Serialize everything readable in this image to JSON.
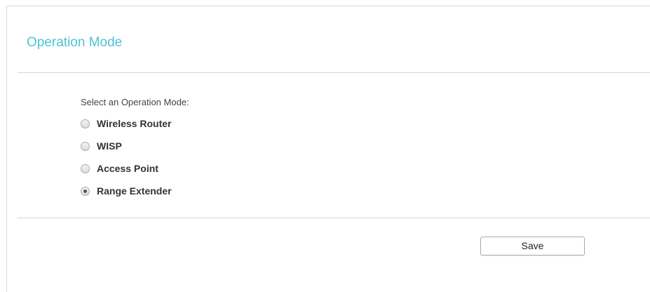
{
  "page": {
    "title": "Operation Mode",
    "accent_color": "#4fc3d6"
  },
  "form": {
    "prompt": "Select an Operation Mode:",
    "options": [
      {
        "label": "Wireless Router",
        "selected": false
      },
      {
        "label": "WISP",
        "selected": false
      },
      {
        "label": "Access Point",
        "selected": false
      },
      {
        "label": "Range Extender",
        "selected": true
      }
    ],
    "save_label": "Save"
  }
}
